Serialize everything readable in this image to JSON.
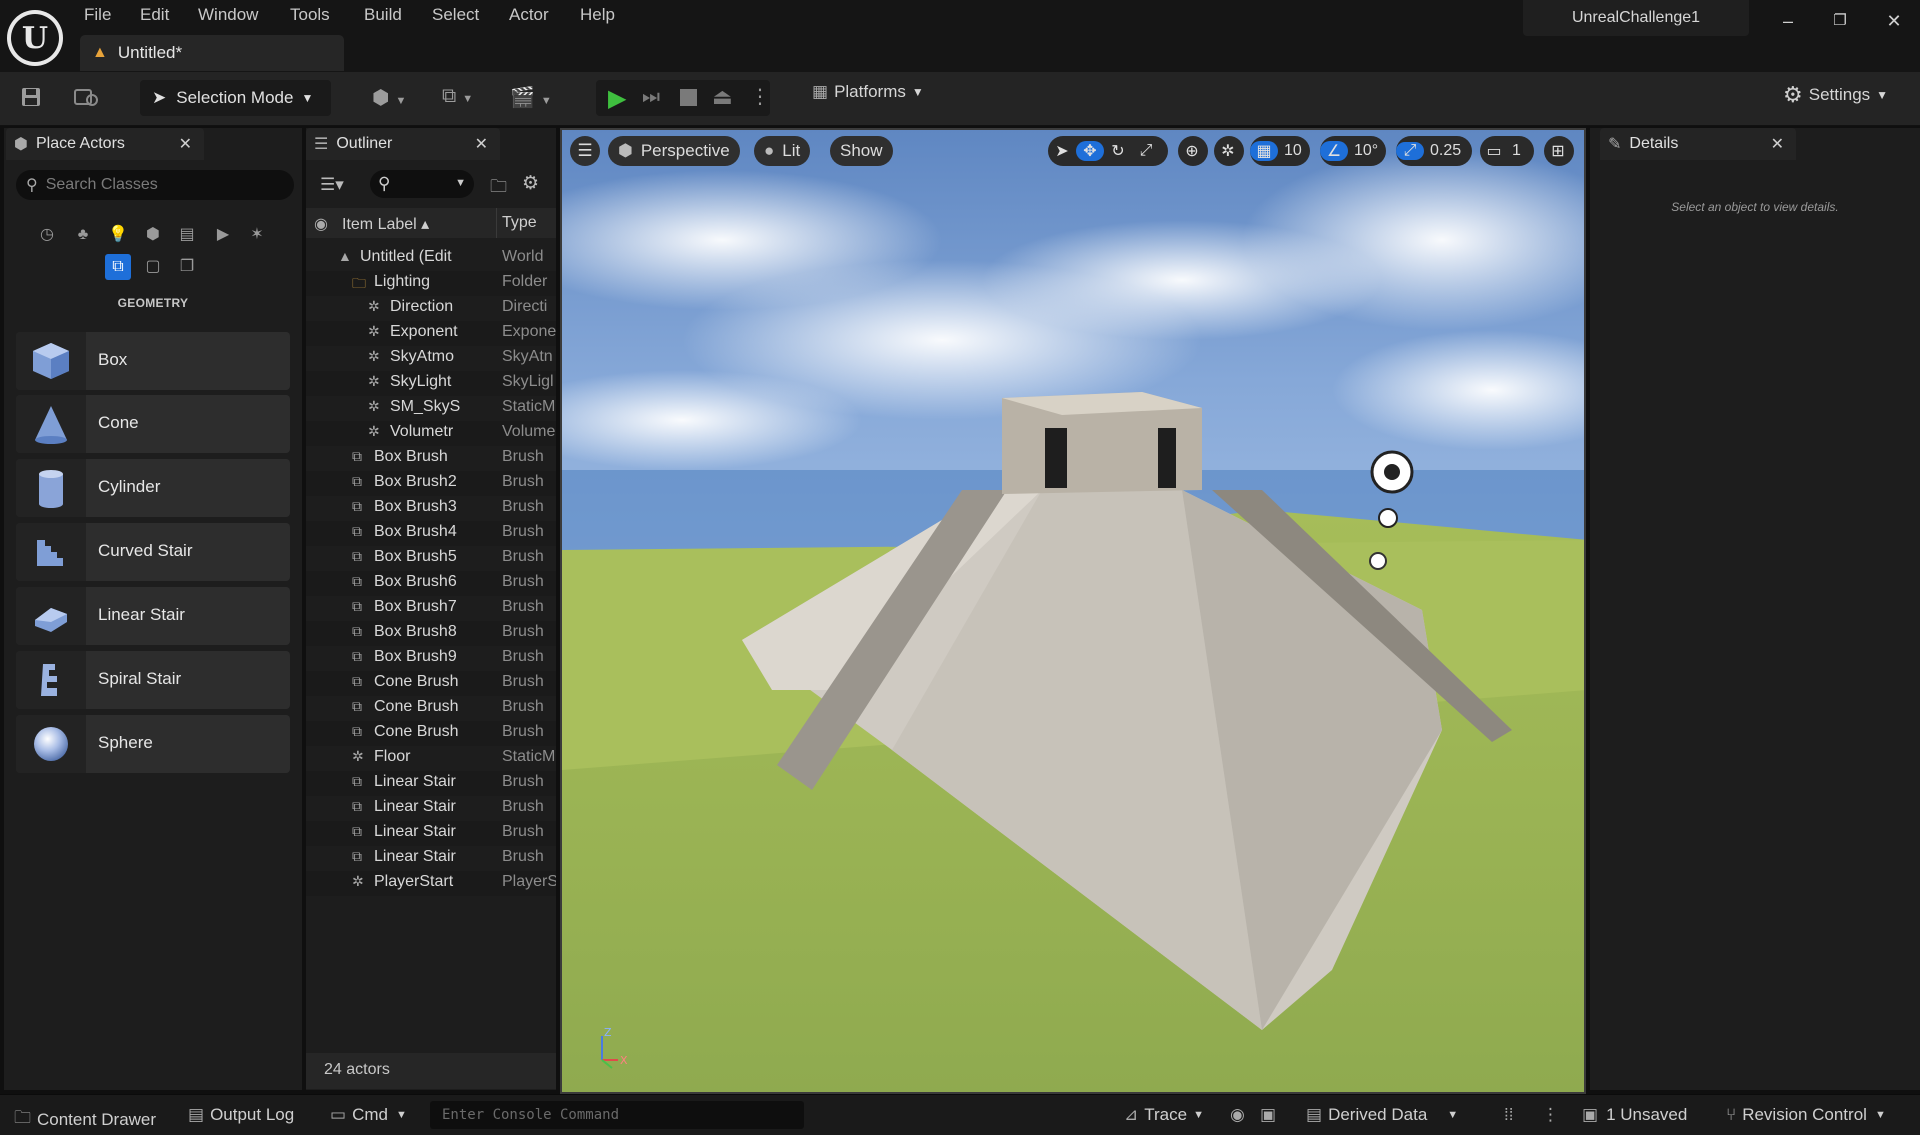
{
  "title_bar": {
    "menu": [
      "File",
      "Edit",
      "Window",
      "Tools",
      "Build",
      "Select",
      "Actor",
      "Help"
    ],
    "doc_tab": "Untitled*",
    "project_name": "UnrealChallenge1"
  },
  "toolbar": {
    "selection_mode": "Selection Mode",
    "platforms": "Platforms",
    "settings": "Settings"
  },
  "place_actors": {
    "tab": "Place Actors",
    "search_placeholder": "Search Classes",
    "category": "GEOMETRY",
    "items": [
      "Box",
      "Cone",
      "Cylinder",
      "Curved Stair",
      "Linear Stair",
      "Spiral Stair",
      "Sphere"
    ]
  },
  "outliner": {
    "tab": "Outliner",
    "col_label": "Item Label",
    "col_type": "Type",
    "rows": [
      {
        "label": "Untitled (Edit",
        "type": "World",
        "depth": 0
      },
      {
        "label": "Lighting",
        "type": "Folder",
        "depth": 1
      },
      {
        "label": "Direction",
        "type": "Directi",
        "depth": 2
      },
      {
        "label": "Exponent",
        "type": "Expone",
        "depth": 2
      },
      {
        "label": "SkyAtmo",
        "type": "SkyAtn",
        "depth": 2
      },
      {
        "label": "SkyLight",
        "type": "SkyLigl",
        "depth": 2
      },
      {
        "label": "SM_SkyS",
        "type": "StaticM",
        "depth": 2
      },
      {
        "label": "Volumetr",
        "type": "Volume",
        "depth": 2
      },
      {
        "label": "Box Brush",
        "type": "Brush",
        "depth": 1
      },
      {
        "label": "Box Brush2",
        "type": "Brush",
        "depth": 1
      },
      {
        "label": "Box Brush3",
        "type": "Brush",
        "depth": 1
      },
      {
        "label": "Box Brush4",
        "type": "Brush",
        "depth": 1
      },
      {
        "label": "Box Brush5",
        "type": "Brush",
        "depth": 1
      },
      {
        "label": "Box Brush6",
        "type": "Brush",
        "depth": 1
      },
      {
        "label": "Box Brush7",
        "type": "Brush",
        "depth": 1
      },
      {
        "label": "Box Brush8",
        "type": "Brush",
        "depth": 1
      },
      {
        "label": "Box Brush9",
        "type": "Brush",
        "depth": 1
      },
      {
        "label": "Cone Brush",
        "type": "Brush",
        "depth": 1
      },
      {
        "label": "Cone Brush",
        "type": "Brush",
        "depth": 1
      },
      {
        "label": "Cone Brush",
        "type": "Brush",
        "depth": 1
      },
      {
        "label": "Floor",
        "type": "StaticM",
        "depth": 1
      },
      {
        "label": "Linear Stair",
        "type": "Brush",
        "depth": 1
      },
      {
        "label": "Linear Stair",
        "type": "Brush",
        "depth": 1
      },
      {
        "label": "Linear Stair",
        "type": "Brush",
        "depth": 1
      },
      {
        "label": "Linear Stair",
        "type": "Brush",
        "depth": 1
      },
      {
        "label": "PlayerStart",
        "type": "PlayerS",
        "depth": 1
      }
    ],
    "actor_count": "24 actors"
  },
  "viewport": {
    "view_mode": "Perspective",
    "lighting": "Lit",
    "show": "Show",
    "grid_snap": "10",
    "rotation_snap": "10°",
    "scale_snap": "0.25",
    "camera_speed": "1"
  },
  "details": {
    "tab": "Details",
    "hint": "Select an object to view details."
  },
  "status_bar": {
    "content_drawer": "Content Drawer",
    "output_log": "Output Log",
    "cmd": "Cmd",
    "console_placeholder": "Enter Console Command",
    "trace": "Trace",
    "derived_data": "Derived Data",
    "unsaved": "1 Unsaved",
    "revision_control": "Revision Control"
  }
}
